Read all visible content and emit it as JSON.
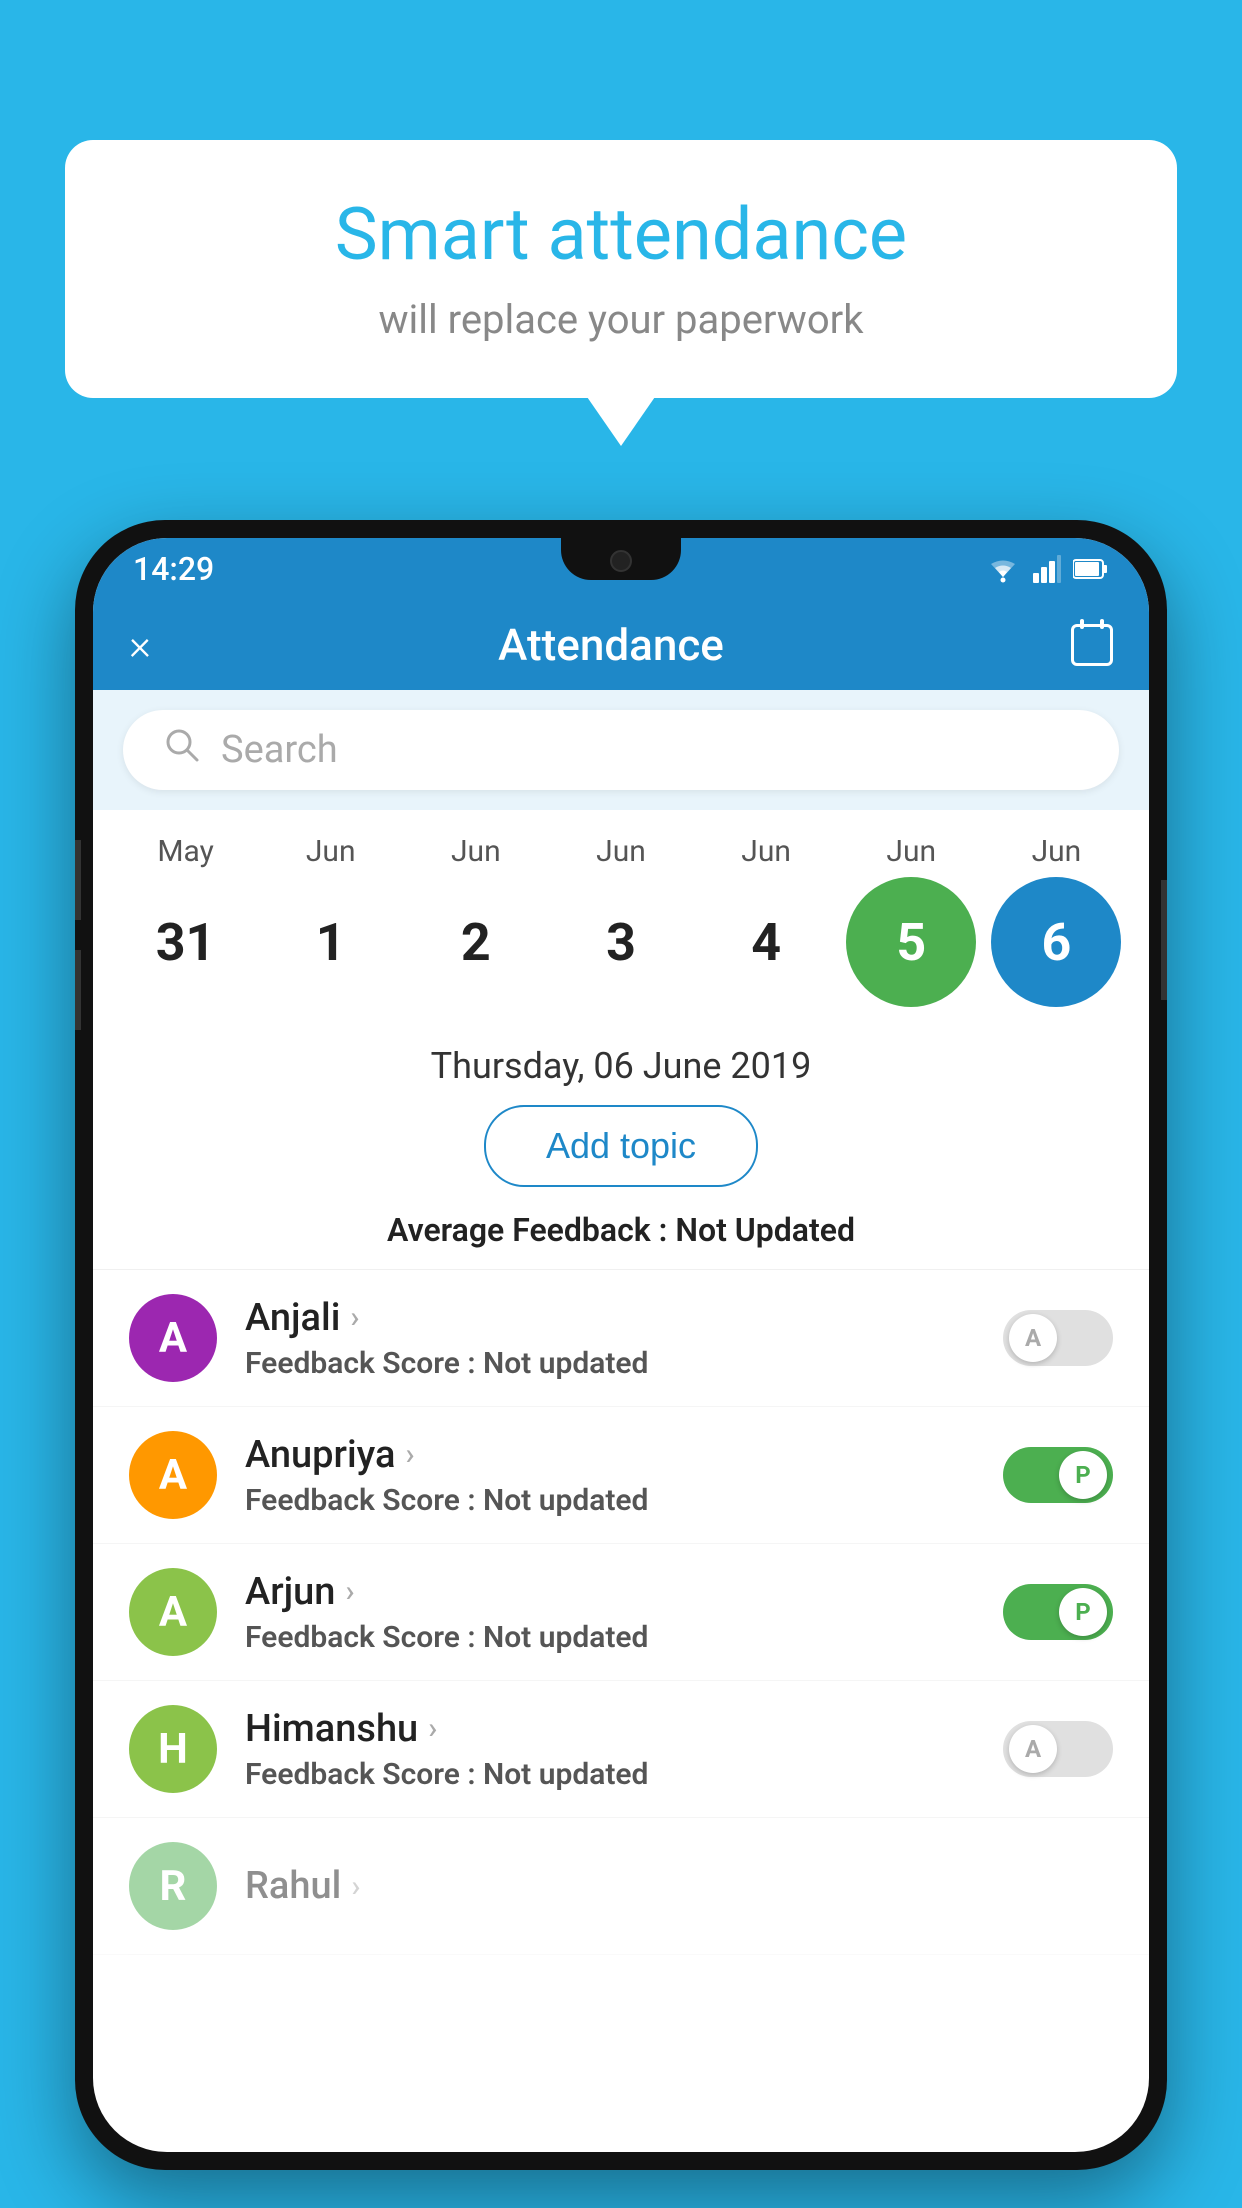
{
  "background_color": "#29b6e8",
  "bubble": {
    "title": "Smart attendance",
    "subtitle": "will replace your paperwork"
  },
  "app": {
    "header": {
      "title": "Attendance",
      "close_label": "×",
      "calendar_label": "📅"
    },
    "status_bar": {
      "time": "14:29",
      "icons": [
        "wifi",
        "signal",
        "battery"
      ]
    },
    "search": {
      "placeholder": "Search"
    },
    "calendar": {
      "months": [
        "May",
        "Jun",
        "Jun",
        "Jun",
        "Jun",
        "Jun",
        "Jun"
      ],
      "dates": [
        "31",
        "1",
        "2",
        "3",
        "4",
        "5",
        "6"
      ],
      "states": [
        "normal",
        "normal",
        "normal",
        "normal",
        "normal",
        "today",
        "selected"
      ]
    },
    "selected_date": "Thursday, 06 June 2019",
    "add_topic_label": "Add topic",
    "avg_feedback_label": "Average Feedback : ",
    "avg_feedback_value": "Not Updated",
    "students": [
      {
        "name": "Anjali",
        "avatar_letter": "A",
        "avatar_color": "#9c27b0",
        "feedback_label": "Feedback Score : ",
        "feedback_value": "Not updated",
        "attendance": "absent",
        "toggle_letter": "A"
      },
      {
        "name": "Anupriya",
        "avatar_letter": "A",
        "avatar_color": "#ff9800",
        "feedback_label": "Feedback Score : ",
        "feedback_value": "Not updated",
        "attendance": "present",
        "toggle_letter": "P"
      },
      {
        "name": "Arjun",
        "avatar_letter": "A",
        "avatar_color": "#8bc34a",
        "feedback_label": "Feedback Score : ",
        "feedback_value": "Not updated",
        "attendance": "present",
        "toggle_letter": "P"
      },
      {
        "name": "Himanshu",
        "avatar_letter": "H",
        "avatar_color": "#8bc34a",
        "feedback_label": "Feedback Score : ",
        "feedback_value": "Not updated",
        "attendance": "absent",
        "toggle_letter": "A"
      }
    ]
  }
}
